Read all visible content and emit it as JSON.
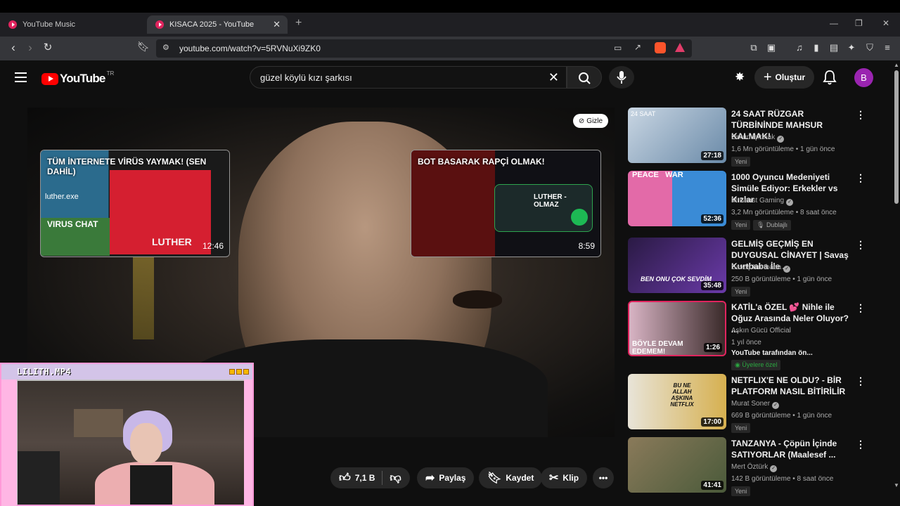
{
  "browser": {
    "tabs": [
      {
        "title": "YouTube Music",
        "active": false
      },
      {
        "title": "KISACA 2025 - YouTube",
        "active": true
      }
    ],
    "url": "youtube.com/watch?v=5RVNuXi9ZK0"
  },
  "header": {
    "logo_text": "YouTube",
    "region": "TR",
    "search_value": "güzel köylü kızı şarkısı",
    "create_label": "Oluştur",
    "avatar_letter": "B"
  },
  "player": {
    "hide_label": "Gizle",
    "endcards": [
      {
        "title": "TÜM İNTERNETE VİRÜS YAYMAK! (SEN DAHİL)",
        "duration": "12:46",
        "overlay_text": [
          "luther.exe",
          "VIRUS CHAT",
          "LUTHER"
        ]
      },
      {
        "title": "BOT BASARAK RAPÇİ OLMAK!",
        "duration": "8:59",
        "overlay_text": [
          "LUTHER - OLMAZ"
        ]
      }
    ]
  },
  "actions": {
    "likes": "7,1 B",
    "share": "Paylaş",
    "save": "Kaydet",
    "clip": "Klip"
  },
  "pip": {
    "title": "LILITH.MP4"
  },
  "sidebar": {
    "items": [
      {
        "title": "24 SAAT RÜZGAR TÜRBİNİNDE MAHSUR KALMAK!",
        "channel": "Orkun Işıtmak",
        "verified": true,
        "meta": "1,6 Mn görüntüleme • 1 gün önce",
        "badges": [
          "Yeni"
        ],
        "duration": "27:18",
        "thumb_colors": [
          "#c9d6e3",
          "#6a8aa8"
        ],
        "thumb_text": "24 SAAT"
      },
      {
        "title": "1000 Oyuncu Medeniyeti Simüle Ediyor: Erkekler vs Kızlar",
        "channel": "MrBeast Gaming",
        "verified": true,
        "meta": "3,2 Mn görüntüleme • 8 saat önce",
        "badges": [
          "Yeni",
          "Dublajlı"
        ],
        "duration": "52:36",
        "thumb_colors": [
          "#e36aa8",
          "#3a8bd6"
        ],
        "thumb_text": "PEACE   WAR"
      },
      {
        "title": "GELMİŞ GEÇMİŞ EN DUYGUSAL CİNAYET | Savaş Kurtbaba İle ...",
        "channel": "Savaş Kurtbaba",
        "verified": true,
        "meta": "250 B görüntüleme • 1 gün önce",
        "badges": [
          "Yeni"
        ],
        "duration": "35:48",
        "thumb_colors": [
          "#2a1a44",
          "#6a3aa8"
        ],
        "thumb_text": "BEN ONU ÇOK SEVDİM"
      },
      {
        "title": "KATİL'a ÖZEL 💕 Nihle ile Oğuz Arasında Neler Oluyor? ...",
        "channel": "Aşkın Gücü Official",
        "verified": false,
        "meta": "1 yıl önce",
        "extra": "YouTube tarafından ön...",
        "members": "Üyelere özel",
        "badges": [],
        "duration": "1:26",
        "thumb_colors": [
          "#d8b4c4",
          "#3a2a2a"
        ],
        "thumb_text": "BÖYLE DEVAM EDEMEM!"
      },
      {
        "title": "NETFLIX'E NE OLDU? - BİR PLATFORM NASIL BİTİRİLİR",
        "channel": "Murat Soner",
        "verified": true,
        "meta": "669 B görüntüleme • 1 gün önce",
        "badges": [
          "Yeni"
        ],
        "duration": "17:00",
        "thumb_colors": [
          "#e8e4d8",
          "#d6b050"
        ],
        "thumb_text": "BU NE ALLAH AŞKINA NETFLIX"
      },
      {
        "title": "TANZANYA - Çöpün İçinde SATIYORLAR (Maalesef ...",
        "channel": "Mert Öztürk",
        "verified": true,
        "meta": "142 B görüntüleme • 8 saat önce",
        "badges": [
          "Yeni"
        ],
        "duration": "41:41",
        "thumb_colors": [
          "#8a7a5a",
          "#4a5a3a"
        ],
        "thumb_text": ""
      }
    ]
  }
}
